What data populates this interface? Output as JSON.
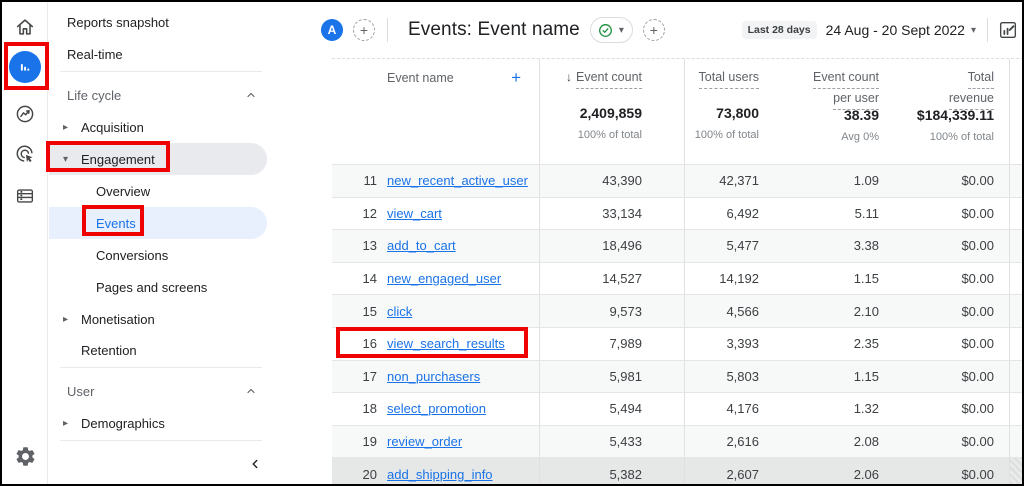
{
  "colors": {
    "accent_blue": "#1a73e8",
    "selected_pill": "#e8f0fe",
    "annotation_red": "#ee0202",
    "check_green": "#1e8e3e"
  },
  "nav_rail": {
    "icons": [
      "home-icon",
      "reports-icon",
      "explore-icon",
      "advertising-icon",
      "library-icon",
      "settings-gear-icon"
    ]
  },
  "sidebar": {
    "top_items": [
      {
        "label": "Reports snapshot"
      },
      {
        "label": "Real-time"
      }
    ],
    "lifecycle_header": "Life cycle",
    "user_header": "User",
    "acquisition": "Acquisition",
    "engagement": "Engagement",
    "overview": "Overview",
    "events": "Events",
    "conversions": "Conversions",
    "pages_screens": "Pages and screens",
    "monetisation": "Monetisation",
    "retention": "Retention",
    "demographics": "Demographics",
    "collapsed_arrow": "▸",
    "expanded_arrow": "▾",
    "section_chevron": "⌃"
  },
  "header": {
    "avatar": "A",
    "plus": "+",
    "title": "Events: Event name",
    "pill_caret": "▾",
    "date_range_label": "Last 28 days",
    "date_range": "24 Aug - 20 Sept 2022",
    "date_caret": "▾"
  },
  "table": {
    "dimension_header": "Event name",
    "add_dimension": "+",
    "sort_arrow": "↓",
    "metric_headers": {
      "event_count": [
        "Event count"
      ],
      "total_users": [
        "Total users"
      ],
      "per_user": [
        "Event count",
        "per user"
      ],
      "revenue": [
        "Total",
        "revenue"
      ]
    },
    "totals": {
      "event_count": "2,409,859",
      "event_count_sub": "100% of total",
      "total_users": "73,800",
      "total_users_sub": "100% of total",
      "per_user": "38.39",
      "per_user_sub": "Avg 0%",
      "revenue": "$184,339.11",
      "revenue_sub": "100% of total"
    },
    "rows": [
      {
        "num": "11",
        "name": "new_recent_active_user",
        "event_count": "43,390",
        "total_users": "42,371",
        "per_user": "1.09",
        "revenue": "$0.00"
      },
      {
        "num": "12",
        "name": "view_cart",
        "event_count": "33,134",
        "total_users": "6,492",
        "per_user": "5.11",
        "revenue": "$0.00"
      },
      {
        "num": "13",
        "name": "add_to_cart",
        "event_count": "18,496",
        "total_users": "5,477",
        "per_user": "3.38",
        "revenue": "$0.00"
      },
      {
        "num": "14",
        "name": "new_engaged_user",
        "event_count": "14,527",
        "total_users": "14,192",
        "per_user": "1.15",
        "revenue": "$0.00"
      },
      {
        "num": "15",
        "name": "click",
        "event_count": "9,573",
        "total_users": "4,566",
        "per_user": "2.10",
        "revenue": "$0.00"
      },
      {
        "num": "16",
        "name": "view_search_results",
        "event_count": "7,989",
        "total_users": "3,393",
        "per_user": "2.35",
        "revenue": "$0.00"
      },
      {
        "num": "17",
        "name": "non_purchasers",
        "event_count": "5,981",
        "total_users": "5,803",
        "per_user": "1.15",
        "revenue": "$0.00"
      },
      {
        "num": "18",
        "name": "select_promotion",
        "event_count": "5,494",
        "total_users": "4,176",
        "per_user": "1.32",
        "revenue": "$0.00"
      },
      {
        "num": "19",
        "name": "review_order",
        "event_count": "5,433",
        "total_users": "2,616",
        "per_user": "2.08",
        "revenue": "$0.00"
      },
      {
        "num": "20",
        "name": "add_shipping_info",
        "event_count": "5,382",
        "total_users": "2,607",
        "per_user": "2.06",
        "revenue": "$0.00"
      }
    ]
  }
}
